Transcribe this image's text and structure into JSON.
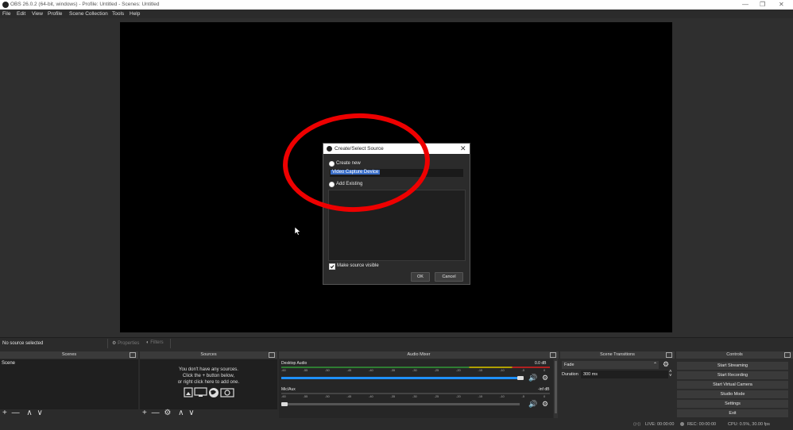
{
  "window": {
    "title": "OBS 26.0.2 (64-bit, windows) - Profile: Untitled - Scenes: Untitled",
    "controls": {
      "minimize": "—",
      "maximize": "❐",
      "close": "✕"
    }
  },
  "menu": [
    "File",
    "Edit",
    "View",
    "Profile",
    "Scene Collection",
    "Tools",
    "Help"
  ],
  "dialog": {
    "title": "Create/Select Source",
    "close": "✕",
    "create_new_label": "Create new",
    "create_new_value": "Video Capture Device",
    "add_existing_label": "Add Existing",
    "make_visible_label": "Make source visible",
    "make_visible_checked": true,
    "ok_label": "OK",
    "cancel_label": "Cancel"
  },
  "source_strip": {
    "status": "No source selected",
    "properties_label": "Properties",
    "filters_label": "Filters"
  },
  "docks": {
    "scenes": {
      "title": "Scenes",
      "items": [
        "Scene"
      ],
      "add": "+",
      "remove": "—",
      "up": "∧",
      "down": "∨"
    },
    "sources": {
      "title": "Sources",
      "empty_line1": "You don't have any sources.",
      "empty_line2": "Click the + button below,",
      "empty_line3": "or right click here to add one.",
      "add": "+",
      "remove": "—",
      "settings": "⚙",
      "up": "∧",
      "down": "∨"
    },
    "audio_mixer": {
      "title": "Audio Mixer",
      "channels": [
        {
          "name": "Desktop Audio",
          "db": "0.0 dB",
          "level": 0.85
        },
        {
          "name": "Mic/Aux",
          "db": "-inf dB",
          "level": 0.0
        }
      ],
      "ticks": [
        "-60",
        "-55",
        "-50",
        "-45",
        "-40",
        "-35",
        "-30",
        "-25",
        "-20",
        "-15",
        "-10",
        "-5",
        "0"
      ]
    },
    "scene_transitions": {
      "title": "Scene Transitions",
      "transition": "Fade",
      "duration_label": "Duration",
      "duration_value": "300 ms"
    },
    "controls": {
      "title": "Controls",
      "buttons": [
        "Start Streaming",
        "Start Recording",
        "Start Virtual Camera",
        "Studio Mode",
        "Settings",
        "Exit"
      ]
    }
  },
  "status": {
    "live": "LIVE: 00:00:00",
    "rec": "REC: 00:00:00",
    "cpu": "CPU: 0.5%, 30.00 fps"
  },
  "colors": {
    "accent": "#1e90ff",
    "highlight": "#ee0000",
    "selection": "#3a6ec8"
  }
}
